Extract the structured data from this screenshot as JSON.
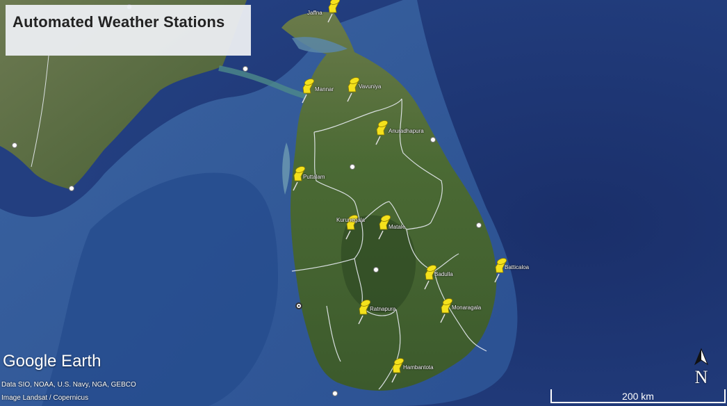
{
  "title": "Automated Weather Stations",
  "logo_text": "Google Earth",
  "attribution": [
    "Data SIO, NOAA, U.S. Navy, NGA, GEBCO",
    "Image Landsat / Copernicus"
  ],
  "scale_label": "200 km",
  "north_label": "N",
  "colors": {
    "pin": "#f4e11c",
    "boundary": "#e8ecf2",
    "ocean": "#1d3a78",
    "land": "#3d5a2c"
  },
  "stations": [
    {
      "name": "Jaffna"
    },
    {
      "name": "Mannar"
    },
    {
      "name": "Vavuniya"
    },
    {
      "name": "Anuradhapura"
    },
    {
      "name": "Puttalam"
    },
    {
      "name": "Kurunegala"
    },
    {
      "name": "Matale"
    },
    {
      "name": "Badulla"
    },
    {
      "name": "Batticaloa"
    },
    {
      "name": "Ratnapura"
    },
    {
      "name": "Monaragala"
    },
    {
      "name": "Hambantota"
    }
  ]
}
